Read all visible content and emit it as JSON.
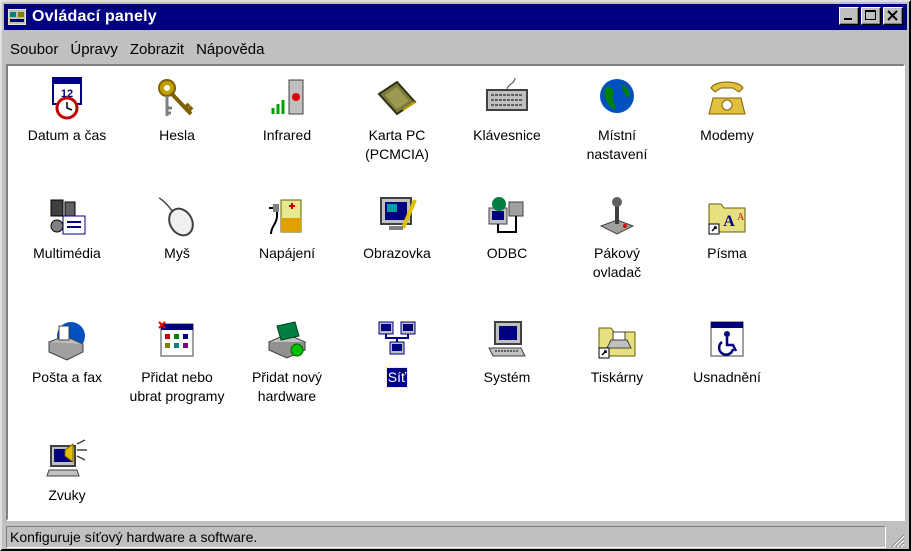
{
  "window": {
    "title": "Ovládací panely"
  },
  "menubar": {
    "items": [
      "Soubor",
      "Úpravy",
      "Zobrazit",
      "Nápověda"
    ]
  },
  "items": [
    {
      "label": "Datum a čas",
      "icon": "calendar-clock-icon"
    },
    {
      "label": "Hesla",
      "icon": "keys-icon"
    },
    {
      "label": "Infrared",
      "icon": "infrared-icon"
    },
    {
      "label": "Karta PC\n(PCMCIA)",
      "icon": "pc-card-icon"
    },
    {
      "label": "Klávesnice",
      "icon": "keyboard-icon"
    },
    {
      "label": "Místní\nnastavení",
      "icon": "globe-icon"
    },
    {
      "label": "Modemy",
      "icon": "telephone-icon"
    },
    {
      "label": "Multimédia",
      "icon": "multimedia-icon"
    },
    {
      "label": "Myš",
      "icon": "mouse-icon"
    },
    {
      "label": "Napájení",
      "icon": "power-icon"
    },
    {
      "label": "Obrazovka",
      "icon": "display-icon"
    },
    {
      "label": "ODBC",
      "icon": "odbc-icon"
    },
    {
      "label": "Pákový\novladač",
      "icon": "joystick-icon"
    },
    {
      "label": "Písma",
      "icon": "fonts-folder-icon"
    },
    {
      "label": "Pošta a fax",
      "icon": "mail-fax-icon"
    },
    {
      "label": "Přidat nebo\nubrat programy",
      "icon": "add-remove-programs-icon"
    },
    {
      "label": "Přidat nový\nhardware",
      "icon": "add-hardware-icon"
    },
    {
      "label": "Síť",
      "icon": "network-icon",
      "selected": true
    },
    {
      "label": "Systém",
      "icon": "system-computer-icon"
    },
    {
      "label": "Tiskárny",
      "icon": "printers-folder-icon"
    },
    {
      "label": "Usnadnění",
      "icon": "accessibility-icon"
    },
    {
      "label": "Zvuky",
      "icon": "sounds-icon"
    }
  ],
  "statusbar": {
    "text": "Konfiguruje síťový hardware a software."
  },
  "colors": {
    "titlebar": "#000080",
    "face": "#c0c0c0",
    "selection": "#000080"
  }
}
